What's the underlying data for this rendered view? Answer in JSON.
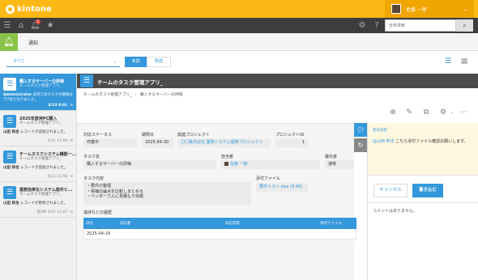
{
  "app": {
    "logo_text": "kintone"
  },
  "user": {
    "name": "佐藤 一郎",
    "chevron": "⌄"
  },
  "nav": {
    "icons": [
      "menu-icon",
      "home-icon",
      "bell-icon",
      "star-icon"
    ],
    "bell_badge": "1",
    "search_placeholder": "全体検索"
  },
  "notifications_header": {
    "title": "通知"
  },
  "filter": {
    "select_value": "すべて",
    "unread_label": "未読",
    "read_label": "既読"
  },
  "notification_list": [
    {
      "title": "購入するサーバーの評価",
      "app": "チームタスク管理アプリ_",
      "body_bold": "Administrator",
      "body": " 未完了のタスクが期限まで7日となりました。",
      "time": "4/23 9:01",
      "active": true
    },
    {
      "title": "2025年度用PC購入",
      "app": "チームタスク管理アプリ_",
      "body_bold": "山田 和也",
      "body": " レコードが追加されました。",
      "time": "4/21 11:09",
      "active": false
    },
    {
      "title": "チームタスクシステム機能一...",
      "app": "チームタスク管理アプリ_",
      "body_bold": "山田 和也",
      "body": " レコードが追加されました。",
      "time": "4/21 11:08",
      "active": false
    },
    {
      "title": "業務効率化システム案件ヒ...",
      "app": "チームタスク管理アプリ_",
      "body_bold": "山田 和也",
      "body": " レコードが更新されました。",
      "body2": "他3件",
      "time": "4/21 11:07",
      "active": false
    }
  ],
  "record": {
    "app_title": "チームのタスク管理アプリ_",
    "breadcrumb": [
      "チームのタスク管理アプリ_",
      "購入するサーバーの評価"
    ],
    "fields": {
      "status_label": "対応ステータス",
      "status_value": "作業中",
      "due_label": "期限日",
      "due_value": "2025-04-30",
      "project_label": "関連プロジェクト",
      "project_value": "〇〇株式会社 業務システム開発プロジェクト",
      "project_id_label": "プロジェクトID",
      "project_id_value": "1",
      "task_name_label": "タスク名",
      "task_name_value": "購入するサーバーの評価",
      "assignee_label": "担当者",
      "assignee_value": "佐藤 一郎",
      "priority_label": "優先度",
      "priority_value": "通常",
      "task_content_label": "タスク内容",
      "task_content_lines": [
        "・要件の整理",
        "・候補の論点を比較しまとめる",
        "・ベンダーさんに見積もり依頼"
      ],
      "attachment_label": "添付ファイル",
      "attachment_value": "要件リスト.xlsx (9 KB)"
    },
    "history": {
      "label": "進捗などの履歴",
      "columns": [
        "日付",
        "対応者",
        "対応内容",
        "添付ファイル"
      ],
      "rows": [
        {
          "date": "2025-04-19",
          "person": "",
          "content": "",
          "file": ""
        }
      ]
    }
  },
  "comments": {
    "hint": "宛先指定",
    "draft_mention": "@山田 和也",
    "draft_text": " こちら添付ファイル確認お願いします。",
    "cancel_label": "キャンセル",
    "post_label": "書き込む",
    "empty_text": "コメントはありません。"
  }
}
